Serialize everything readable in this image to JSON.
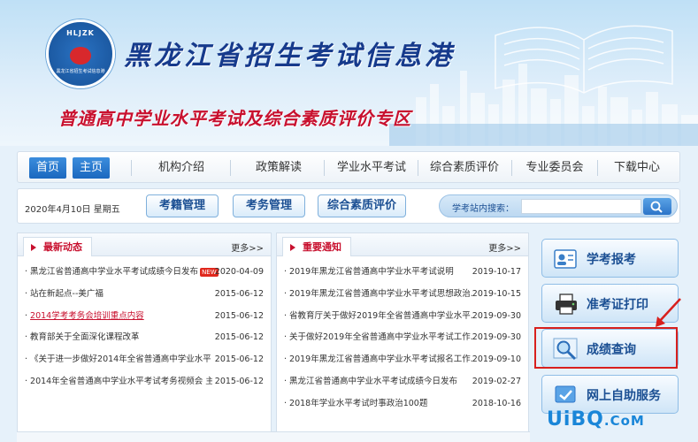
{
  "header": {
    "logo_text": "HLJZK",
    "logo_ring": "黑龙江省招生考试信息港",
    "site_title": "黑龙江省招生考试信息港",
    "subtitle": "普通高中学业水平考试及综合素质评价专区"
  },
  "nav": {
    "home": "首页",
    "main": "主页",
    "items": [
      "机构介绍",
      "政策解读",
      "学业水平考试",
      "综合素质评价",
      "专业委员会",
      "下载中心"
    ]
  },
  "toolbar": {
    "date": "2020年4月10日  星期五",
    "buttons": [
      "考籍管理",
      "考务管理",
      "综合素质评价"
    ],
    "search_label": "学考站内搜索：",
    "search_value": ""
  },
  "latest_news": {
    "title": "最新动态",
    "more": "更多>>",
    "new_badge": "NEW",
    "items": [
      {
        "title": "黑龙江省普通高中学业水平考试成绩今日发布",
        "date": "2020-04-09",
        "new": true,
        "highlight": false
      },
      {
        "title": "站在新起点--美广福",
        "date": "2015-06-12",
        "new": false,
        "highlight": false
      },
      {
        "title": "2014学考考务会培训重点内容",
        "date": "2015-06-12",
        "new": false,
        "highlight": true
      },
      {
        "title": "教育部关于全面深化课程改革",
        "date": "2015-06-12",
        "new": false,
        "highlight": false
      },
      {
        "title": "《关于进一步做好2014年全省普通高中学业水平...",
        "date": "2015-06-12",
        "new": false,
        "highlight": false
      },
      {
        "title": "2014年全省普通高中学业水平考试考务视频会 主...",
        "date": "2015-06-12",
        "new": false,
        "highlight": false
      }
    ]
  },
  "notices": {
    "title": "重要通知",
    "more": "更多>>",
    "items": [
      {
        "title": "2019年黑龙江省普通高中学业水平考试说明",
        "date": "2019-10-17"
      },
      {
        "title": "2019年黑龙江省普通高中学业水平考试思想政治...",
        "date": "2019-10-15"
      },
      {
        "title": "省教育厅关于做好2019年全省普通高中学业水平...",
        "date": "2019-09-30"
      },
      {
        "title": "关于做好2019年全省普通高中学业水平考试工作...",
        "date": "2019-09-30"
      },
      {
        "title": "2019年黑龙江省普通高中学业水平考试报名工作...",
        "date": "2019-09-10"
      },
      {
        "title": "黑龙江省普通高中学业水平考试成绩今日发布",
        "date": "2019-02-27"
      },
      {
        "title": "2018年学业水平考试时事政治100题",
        "date": "2018-10-16"
      }
    ]
  },
  "side": {
    "buttons": [
      "学考报考",
      "准考证打印",
      "成绩查询",
      "网上自助服务"
    ],
    "highlighted_index": 2
  },
  "watermark": {
    "text": "UiBQ",
    "suffix": ".CoM"
  },
  "colors": {
    "accent": "#1b68bf",
    "red": "#c8102e",
    "highlight_box": "#d8201d"
  }
}
